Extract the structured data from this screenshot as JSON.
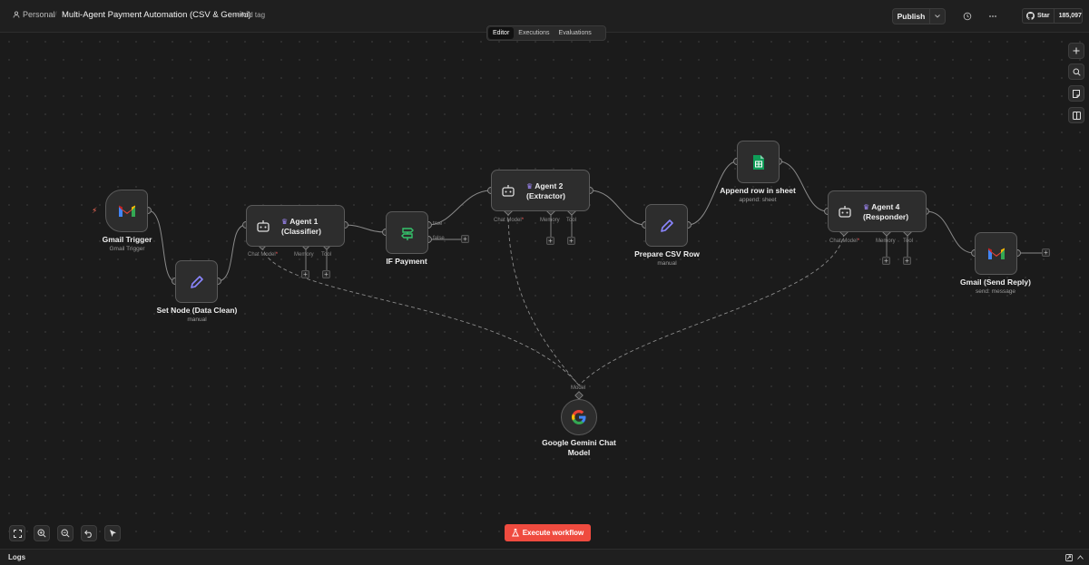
{
  "header": {
    "workspace": "Personal",
    "separator": "/",
    "workflow_title": "Multi-Agent Payment Automation (CSV & Gemini)",
    "add_tag": "+ Add tag",
    "publish": "Publish",
    "github": {
      "star": "Star",
      "count": "185,097"
    }
  },
  "tabs": [
    {
      "label": "Editor",
      "active": true
    },
    {
      "label": "Executions",
      "active": false
    },
    {
      "label": "Evaluations",
      "active": false
    }
  ],
  "nodes": {
    "gmail_trigger": {
      "title": "Gmail Trigger",
      "subtitle": "Gmail Trigger"
    },
    "set_node": {
      "title": "Set Node (Data Clean)",
      "subtitle": "manual"
    },
    "agent1": {
      "title_line1": "Agent 1",
      "title_line2": "(Classifier)"
    },
    "if_payment": {
      "title": "IF Payment",
      "true_label": "true",
      "false_label": "false"
    },
    "agent2": {
      "title_line1": "Agent 2",
      "title_line2": "(Extractor)"
    },
    "prepare_csv": {
      "title": "Prepare CSV Row",
      "subtitle": "manual"
    },
    "append_sheet": {
      "title": "Append row in sheet",
      "subtitle": "append: sheet"
    },
    "agent4": {
      "title_line1": "Agent 4",
      "title_line2": "(Responder)"
    },
    "gmail_reply": {
      "title": "Gmail (Send Reply)",
      "subtitle": "send: message"
    },
    "gemini": {
      "title_line1": "Google Gemini Chat",
      "title_line2": "Model",
      "port_label": "Model"
    }
  },
  "ports": {
    "chat_model": "Chat Model",
    "required_mark": "*",
    "memory": "Memory",
    "tool": "Tool"
  },
  "execute_button": "Execute workflow",
  "logs_label": "Logs",
  "colors": {
    "background": "#1b1b1b",
    "accent": "#ef4b3f",
    "node_border": "#5a5a5a",
    "gmail_red": "#ea4335",
    "sheets_green": "#0f9d58",
    "if_green": "#35c46b",
    "pencil_purple": "#7b7bff"
  },
  "icons": [
    "person-icon",
    "history-icon",
    "more-icon",
    "github-icon",
    "plus-icon",
    "search-icon",
    "sticky-note-icon",
    "panel-icon",
    "fit-view-icon",
    "zoom-in-icon",
    "zoom-out-icon",
    "undo-icon",
    "select-icon",
    "flask-icon",
    "gmail-icon",
    "pencil-icon",
    "robot-icon",
    "branch-icon",
    "sheets-icon",
    "google-icon",
    "bolt-icon"
  ]
}
